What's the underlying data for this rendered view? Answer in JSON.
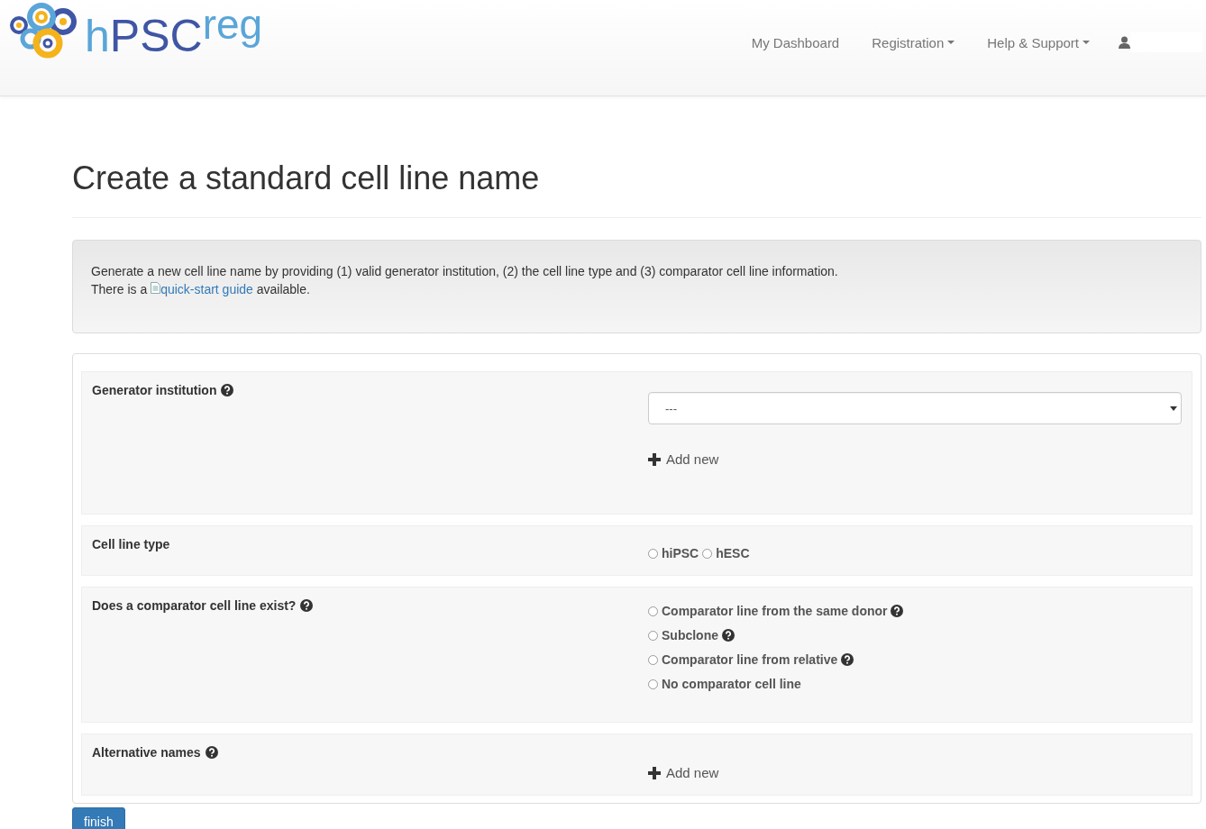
{
  "brand": {
    "main": "hPSC",
    "sup": "reg"
  },
  "nav": [
    {
      "label": "My Dashboard",
      "dropdown": false
    },
    {
      "label": "Registration",
      "dropdown": true
    },
    {
      "label": "Help & Support",
      "dropdown": true
    }
  ],
  "title": "Create a standard cell line name",
  "info": {
    "line1": "Generate a new cell line name by providing (1) valid generator institution, (2) the cell line type and (3) comparator cell line information.",
    "line2_before": "There is a",
    "link": "quick-start guide",
    "line2_after": "available."
  },
  "sections": [
    {
      "label": "Generator institution",
      "help": true,
      "kind": "select",
      "value": "---",
      "add": "Add new"
    },
    {
      "label": "Cell line type",
      "help": false,
      "kind": "radio-inline",
      "options": [
        {
          "label": "hiPSC",
          "help": false,
          "selected": false
        },
        {
          "label": "hESC",
          "help": false,
          "selected": false
        }
      ]
    },
    {
      "label": "Does a comparator cell line exist?",
      "help": true,
      "kind": "radio-stacked",
      "options": [
        {
          "label": "Comparator line from the same donor",
          "help": true,
          "selected": false
        },
        {
          "label": "Subclone",
          "help": true,
          "selected": false
        },
        {
          "label": "Comparator line from relative",
          "help": true,
          "selected": false
        },
        {
          "label": "No comparator cell line",
          "help": false,
          "selected": false
        }
      ]
    },
    {
      "label": "Alternative names",
      "help": true,
      "kind": "add",
      "add": "Add new"
    }
  ],
  "submit": "finish"
}
